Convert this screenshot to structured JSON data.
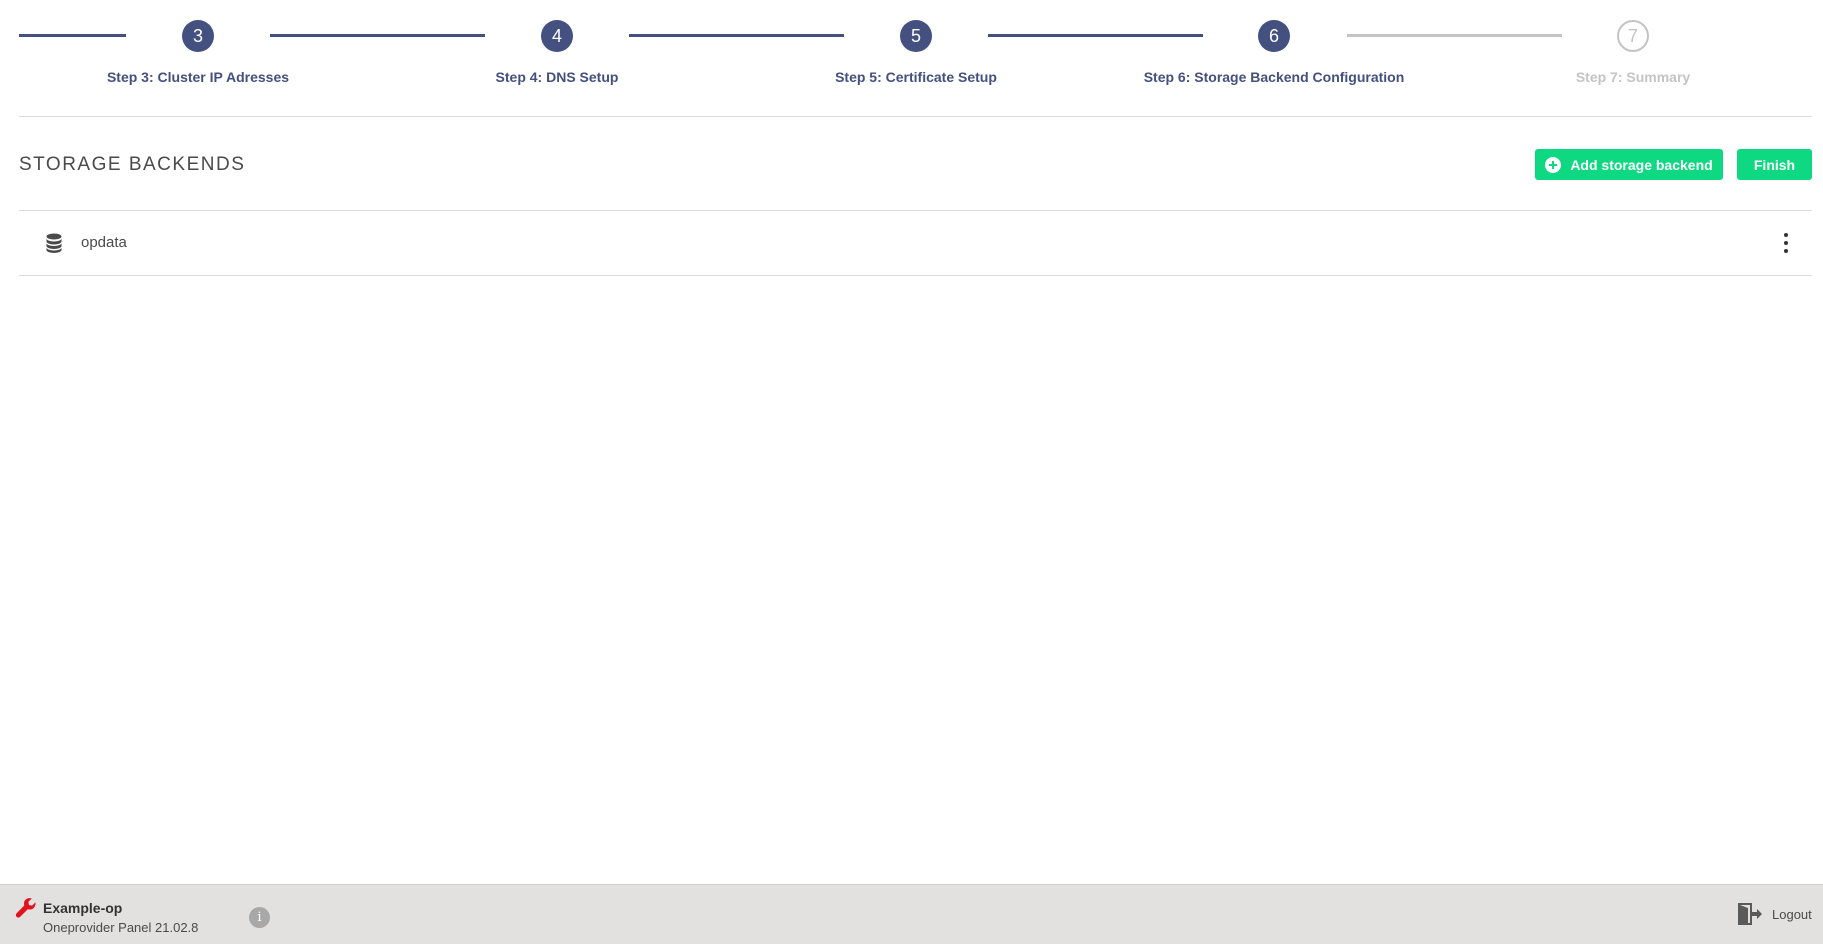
{
  "stepper": {
    "steps": [
      {
        "number": "3",
        "label": "Step 3: Cluster IP Adresses",
        "state": "done"
      },
      {
        "number": "4",
        "label": "Step 4: DNS Setup",
        "state": "done"
      },
      {
        "number": "5",
        "label": "Step 5: Certificate Setup",
        "state": "done"
      },
      {
        "number": "6",
        "label": "Step 6: Storage Backend Configuration",
        "state": "active"
      },
      {
        "number": "7",
        "label": "Step 7: Summary",
        "state": "pending"
      }
    ]
  },
  "header": {
    "title": "STORAGE BACKENDS",
    "add_button_label": "Add storage backend",
    "add_button_icon": "plus-circle-icon",
    "finish_button_label": "Finish"
  },
  "storages": [
    {
      "name": "opdata",
      "icon": "database-icon"
    }
  ],
  "footer": {
    "cluster_name": "Example-op",
    "panel_version": "Oneprovider Panel 21.02.8",
    "info_label": "i",
    "logout_label": "Logout"
  },
  "colors": {
    "accent": "#44507f",
    "inactive": "#c4c4c4",
    "button": "#0ed982",
    "footer_bg": "#e3e1df",
    "wrench": "#e0141e"
  }
}
